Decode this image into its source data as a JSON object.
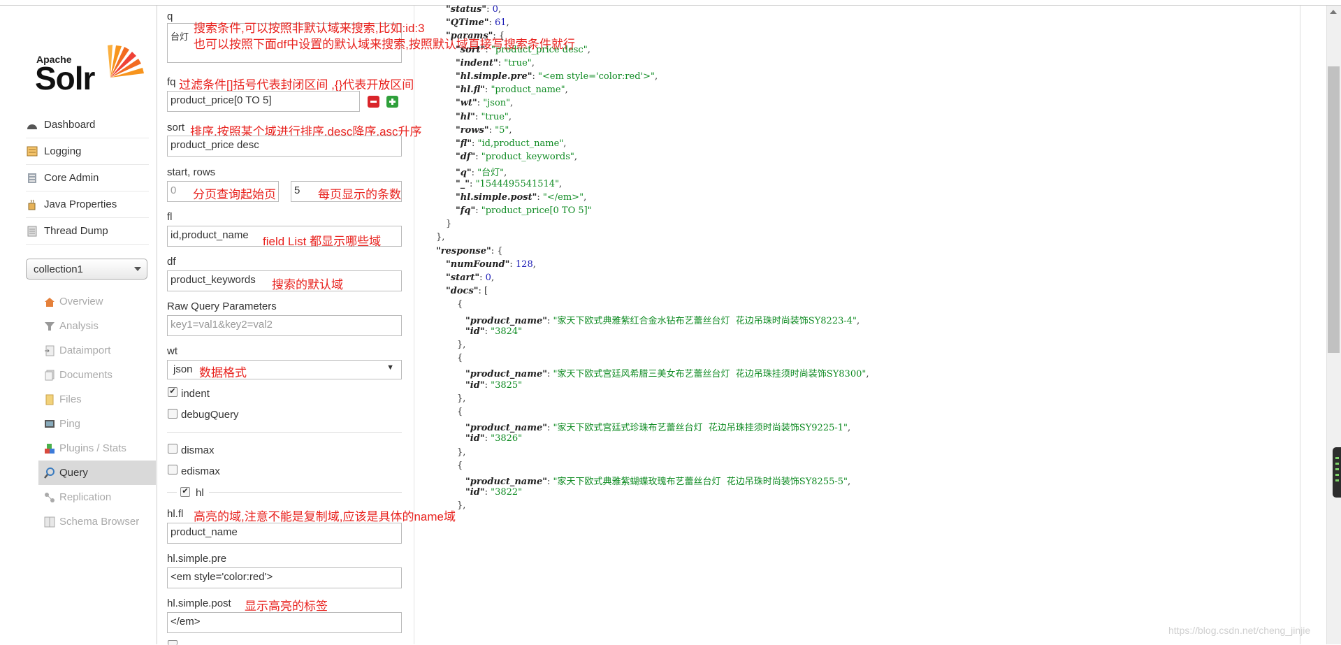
{
  "app": {
    "logo_top": "Apache",
    "logo_main": "Solr"
  },
  "nav": {
    "items": [
      {
        "label": "Dashboard",
        "icon": "dashboard-icon"
      },
      {
        "label": "Logging",
        "icon": "logging-icon"
      },
      {
        "label": "Core Admin",
        "icon": "core-admin-icon"
      },
      {
        "label": "Java Properties",
        "icon": "java-icon"
      },
      {
        "label": "Thread Dump",
        "icon": "thread-dump-icon"
      }
    ],
    "collection": "collection1",
    "core_items": [
      {
        "label": "Overview",
        "icon": "overview-icon"
      },
      {
        "label": "Analysis",
        "icon": "analysis-icon"
      },
      {
        "label": "Dataimport",
        "icon": "dataimport-icon"
      },
      {
        "label": "Documents",
        "icon": "documents-icon"
      },
      {
        "label": "Files",
        "icon": "files-icon"
      },
      {
        "label": "Ping",
        "icon": "ping-icon"
      },
      {
        "label": "Plugins / Stats",
        "icon": "plugins-icon"
      },
      {
        "label": "Query",
        "icon": "query-icon"
      },
      {
        "label": "Replication",
        "icon": "replication-icon"
      },
      {
        "label": "Schema Browser",
        "icon": "schema-icon"
      }
    ]
  },
  "form": {
    "q_label": "q",
    "q_value": "台灯",
    "q_note1": "搜索条件,可以按照非默认域来搜索,比如:id:3",
    "q_note2": "也可以按照下面df中设置的默认域来搜索,按照默认域直接写搜索条件就行",
    "fq_label": "fq",
    "fq_note": "过滤条件[]括号代表封闭区间 ,{}代表开放区间",
    "fq_value": "product_price[0 TO 5]",
    "sort_label": "sort",
    "sort_note": "排序,按照某个域进行排序,desc降序,asc升序",
    "sort_value": "product_price desc",
    "startrows_label": "start, rows",
    "start_value": "0",
    "start_note": "分页查询起始页",
    "rows_value": "5",
    "rows_note": "每页显示的条数",
    "fl_label": "fl",
    "fl_value": "id,product_name",
    "fl_note": "field List 都显示哪些域",
    "df_label": "df",
    "df_value": "product_keywords",
    "df_note": "搜索的默认域",
    "raw_label": "Raw Query Parameters",
    "raw_placeholder": "key1=val1&key2=val2",
    "wt_label": "wt",
    "wt_value": "json",
    "wt_note": "数据格式",
    "indent_label": "indent",
    "debug_label": "debugQuery",
    "dismax_label": "dismax",
    "edismax_label": "edismax",
    "hl_label": "hl",
    "hlfl_label": "hl.fl",
    "hlfl_note": "高亮的域,注意不能是复制域,应该是具体的name域",
    "hlfl_value": "product_name",
    "hlpre_label": "hl.simple.pre",
    "hlpre_value": "<em style='color:red'>",
    "hlpost_label": "hl.simple.post",
    "hlpost_note": "显示高亮的标签",
    "hlpost_value": "</em>"
  },
  "json_lines": [
    [
      {
        "t": "k",
        "v": "\"status\""
      },
      {
        "t": "p",
        "v": ": "
      },
      {
        "t": "n",
        "v": "0"
      },
      {
        "t": "p",
        "v": ","
      }
    ],
    [
      {
        "t": "k",
        "v": "\"QTime\""
      },
      {
        "t": "p",
        "v": ": "
      },
      {
        "t": "n",
        "v": "61"
      },
      {
        "t": "p",
        "v": ","
      }
    ],
    [
      {
        "t": "k",
        "v": "\"params\""
      },
      {
        "t": "p",
        "v": ": {"
      }
    ],
    [
      {
        "t": "k",
        "v": "\"sort\""
      },
      {
        "t": "p",
        "v": ": "
      },
      {
        "t": "s",
        "v": "\"product_price desc\""
      },
      {
        "t": "p",
        "v": ","
      }
    ],
    [
      {
        "t": "k",
        "v": "\"indent\""
      },
      {
        "t": "p",
        "v": ": "
      },
      {
        "t": "s",
        "v": "\"true\""
      },
      {
        "t": "p",
        "v": ","
      }
    ],
    [
      {
        "t": "k",
        "v": "\"hl.simple.pre\""
      },
      {
        "t": "p",
        "v": ": "
      },
      {
        "t": "s",
        "v": "\"<em style='color:red'>\""
      },
      {
        "t": "p",
        "v": ","
      }
    ],
    [
      {
        "t": "k",
        "v": "\"hl.fl\""
      },
      {
        "t": "p",
        "v": ": "
      },
      {
        "t": "s",
        "v": "\"product_name\""
      },
      {
        "t": "p",
        "v": ","
      }
    ],
    [
      {
        "t": "k",
        "v": "\"wt\""
      },
      {
        "t": "p",
        "v": ": "
      },
      {
        "t": "s",
        "v": "\"json\""
      },
      {
        "t": "p",
        "v": ","
      }
    ],
    [
      {
        "t": "k",
        "v": "\"hl\""
      },
      {
        "t": "p",
        "v": ": "
      },
      {
        "t": "s",
        "v": "\"true\""
      },
      {
        "t": "p",
        "v": ","
      }
    ],
    [
      {
        "t": "k",
        "v": "\"rows\""
      },
      {
        "t": "p",
        "v": ": "
      },
      {
        "t": "s",
        "v": "\"5\""
      },
      {
        "t": "p",
        "v": ","
      }
    ],
    [
      {
        "t": "k",
        "v": "\"fl\""
      },
      {
        "t": "p",
        "v": ": "
      },
      {
        "t": "s",
        "v": "\"id,product_name\""
      },
      {
        "t": "p",
        "v": ","
      }
    ],
    [
      {
        "t": "k",
        "v": "\"df\""
      },
      {
        "t": "p",
        "v": ": "
      },
      {
        "t": "s",
        "v": "\"product_keywords\""
      },
      {
        "t": "p",
        "v": ","
      }
    ],
    [
      {
        "t": "k",
        "v": "\"q\""
      },
      {
        "t": "p",
        "v": ": "
      },
      {
        "t": "s",
        "v": "\"台灯\""
      },
      {
        "t": "p",
        "v": ","
      }
    ],
    [
      {
        "t": "k",
        "v": "\"_\""
      },
      {
        "t": "p",
        "v": ": "
      },
      {
        "t": "s",
        "v": "\"1544495541514\""
      },
      {
        "t": "p",
        "v": ","
      }
    ],
    [
      {
        "t": "k",
        "v": "\"hl.simple.post\""
      },
      {
        "t": "p",
        "v": ": "
      },
      {
        "t": "s",
        "v": "\"</em>\""
      },
      {
        "t": "p",
        "v": ","
      }
    ],
    [
      {
        "t": "k",
        "v": "\"fq\""
      },
      {
        "t": "p",
        "v": ": "
      },
      {
        "t": "s",
        "v": "\"product_price[0 TO 5]\""
      }
    ],
    [
      {
        "t": "p",
        "v": "}"
      }
    ],
    [
      {
        "t": "p",
        "v": "},"
      }
    ],
    [
      {
        "t": "k",
        "v": "\"response\""
      },
      {
        "t": "p",
        "v": ": {"
      }
    ],
    [
      {
        "t": "k",
        "v": "\"numFound\""
      },
      {
        "t": "p",
        "v": ": "
      },
      {
        "t": "n",
        "v": "128"
      },
      {
        "t": "p",
        "v": ","
      }
    ],
    [
      {
        "t": "k",
        "v": "\"start\""
      },
      {
        "t": "p",
        "v": ": "
      },
      {
        "t": "n",
        "v": "0"
      },
      {
        "t": "p",
        "v": ","
      }
    ],
    [
      {
        "t": "k",
        "v": "\"docs\""
      },
      {
        "t": "p",
        "v": ": ["
      }
    ],
    [
      {
        "t": "p",
        "v": "{"
      }
    ],
    [
      {
        "t": "k",
        "v": "\"product_name\""
      },
      {
        "t": "p",
        "v": ": "
      },
      {
        "t": "s",
        "v": "\"家天下欧式典雅紫红合金水钻布艺蕾丝台灯  花边吊珠时尚装饰SY8223-4\""
      },
      {
        "t": "p",
        "v": ","
      }
    ],
    [
      {
        "t": "k",
        "v": "\"id\""
      },
      {
        "t": "p",
        "v": ": "
      },
      {
        "t": "s",
        "v": "\"3824\""
      }
    ],
    [
      {
        "t": "p",
        "v": "},"
      }
    ],
    [
      {
        "t": "p",
        "v": "{"
      }
    ],
    [
      {
        "t": "k",
        "v": "\"product_name\""
      },
      {
        "t": "p",
        "v": ": "
      },
      {
        "t": "s",
        "v": "\"家天下欧式宫廷风希腊三美女布艺蕾丝台灯  花边吊珠挂须时尚装饰SY8300\""
      },
      {
        "t": "p",
        "v": ","
      }
    ],
    [
      {
        "t": "k",
        "v": "\"id\""
      },
      {
        "t": "p",
        "v": ": "
      },
      {
        "t": "s",
        "v": "\"3825\""
      }
    ],
    [
      {
        "t": "p",
        "v": "},"
      }
    ],
    [
      {
        "t": "p",
        "v": "{"
      }
    ],
    [
      {
        "t": "k",
        "v": "\"product_name\""
      },
      {
        "t": "p",
        "v": ": "
      },
      {
        "t": "s",
        "v": "\"家天下欧式宫廷式珍珠布艺蕾丝台灯  花边吊珠挂须时尚装饰SY9225-1\""
      },
      {
        "t": "p",
        "v": ","
      }
    ],
    [
      {
        "t": "k",
        "v": "\"id\""
      },
      {
        "t": "p",
        "v": ": "
      },
      {
        "t": "s",
        "v": "\"3826\""
      }
    ],
    [
      {
        "t": "p",
        "v": "},"
      }
    ],
    [
      {
        "t": "p",
        "v": "{"
      }
    ],
    [
      {
        "t": "k",
        "v": "\"product_name\""
      },
      {
        "t": "p",
        "v": ": "
      },
      {
        "t": "s",
        "v": "\"家天下欧式典雅紫蝴蝶玫瑰布艺蕾丝台灯  花边吊珠时尚装饰SY8255-5\""
      },
      {
        "t": "p",
        "v": ","
      }
    ],
    [
      {
        "t": "k",
        "v": "\"id\""
      },
      {
        "t": "p",
        "v": ": "
      },
      {
        "t": "s",
        "v": "\"3822\""
      }
    ],
    [
      {
        "t": "p",
        "v": "},"
      }
    ]
  ],
  "watermark": "https://blog.csdn.net/cheng_jinjie"
}
